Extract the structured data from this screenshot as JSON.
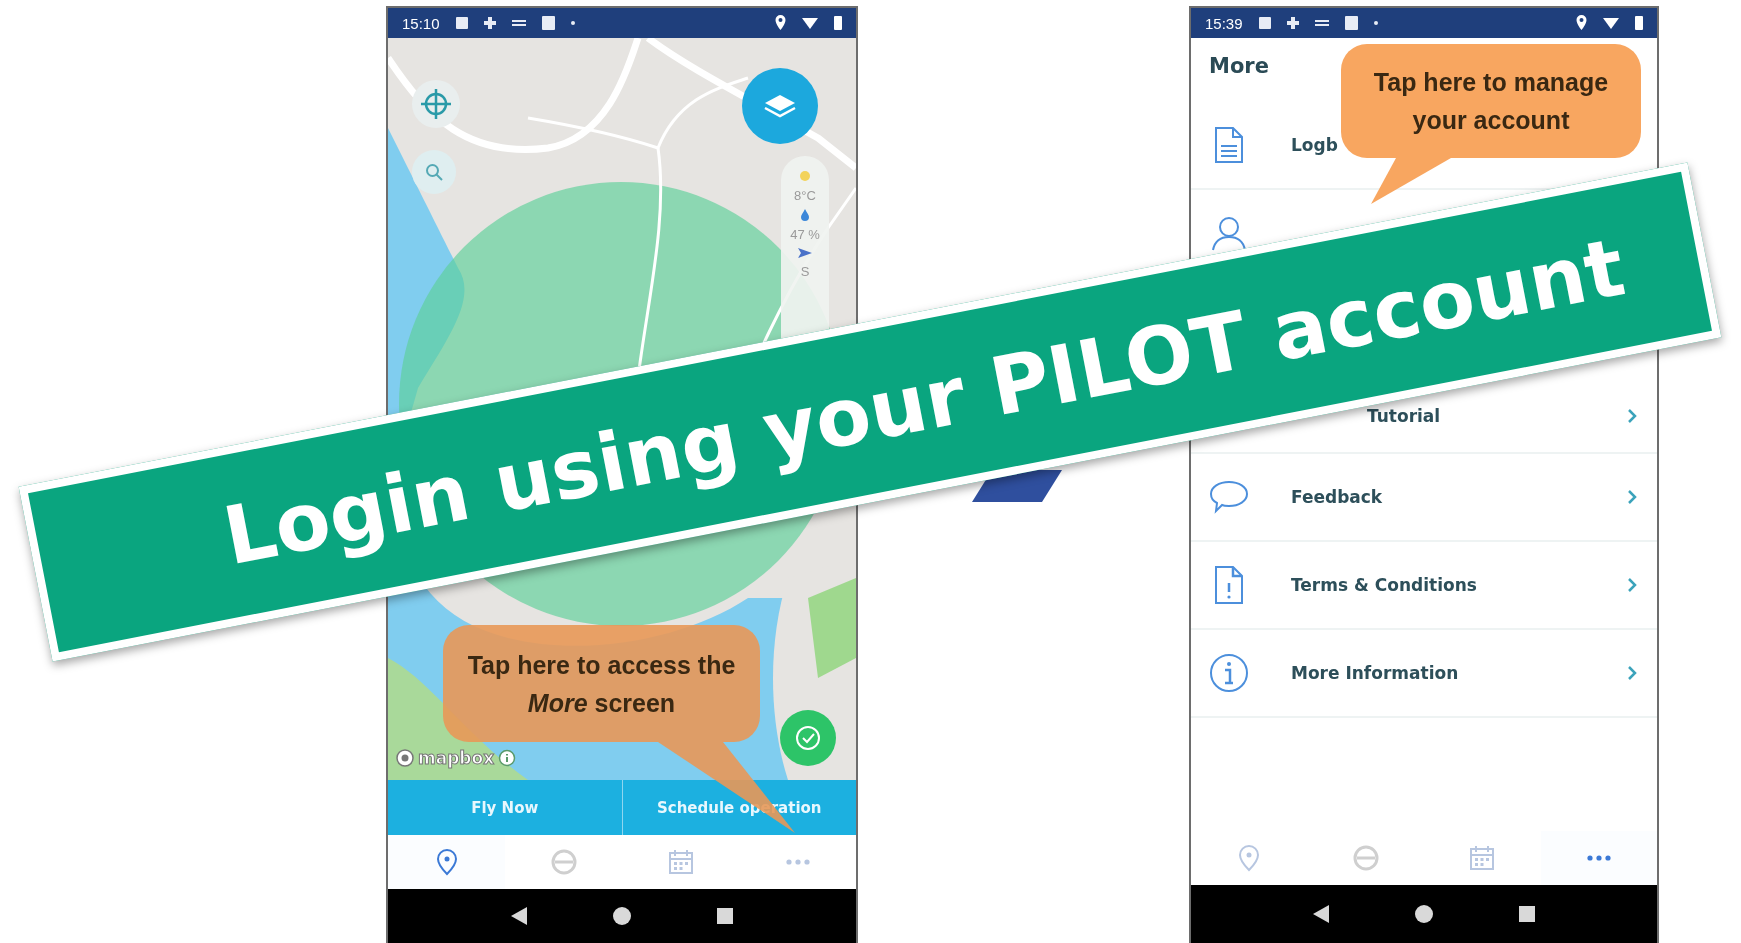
{
  "left_phone": {
    "status_bar": {
      "time": "15:10"
    },
    "map": {
      "weather": [
        "8°C",
        "47 %",
        "S"
      ],
      "attribution": "mapbox"
    },
    "actions": [
      {
        "label": "Fly Now"
      },
      {
        "label": "Schedule operation"
      }
    ],
    "bottom_nav": [
      {
        "kind": "map",
        "selected": true
      },
      {
        "kind": "pilot",
        "selected": false
      },
      {
        "kind": "calendar",
        "selected": false
      },
      {
        "kind": "more",
        "selected": false
      }
    ],
    "callout": {
      "text": "Tap here to access the *More* screen"
    }
  },
  "right_phone": {
    "status_bar": {
      "time": "15:39"
    },
    "title": "More",
    "menu": [
      {
        "kind": "document",
        "label": "Logb"
      },
      {
        "kind": "person"
      },
      {
        "kind": "hidden"
      },
      {
        "kind": "tutorial",
        "label": "Tutorial"
      },
      {
        "kind": "chat",
        "label": "Feedback"
      },
      {
        "kind": "alert-document",
        "label": "Terms & Conditions"
      },
      {
        "kind": "info",
        "label": "More Information"
      }
    ],
    "bottom_nav": [
      {
        "kind": "map",
        "selected": false
      },
      {
        "kind": "pilot",
        "selected": false
      },
      {
        "kind": "calendar",
        "selected": false
      },
      {
        "kind": "more",
        "selected": true
      }
    ],
    "callout": {
      "text": "Tap here to manage your account"
    }
  },
  "banner": {
    "text": "Login using your PILOT account"
  }
}
